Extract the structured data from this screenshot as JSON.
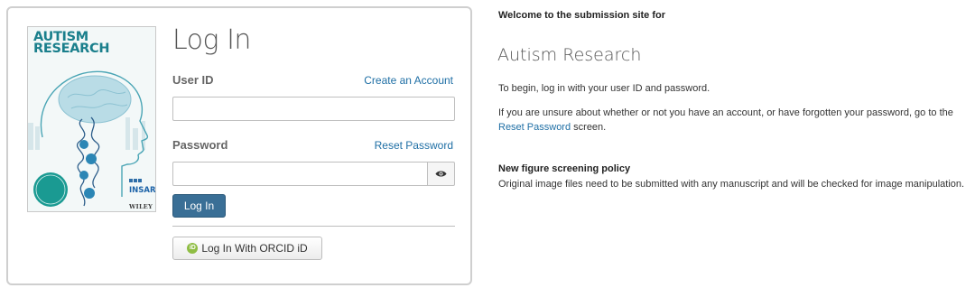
{
  "cover": {
    "title_line1": "AUTISM",
    "title_line2": "RESEARCH",
    "brand": "INSAR",
    "publisher": "WILEY",
    "accent_color": "#1a7f8c"
  },
  "login": {
    "title": "Log In",
    "user_id_label": "User ID",
    "create_account_link": "Create an Account",
    "user_id_value": "",
    "password_label": "Password",
    "reset_password_link": "Reset Password",
    "password_value": "",
    "show_password_icon": "eye-icon",
    "login_button": "Log In",
    "orcid_icon_text": "iD",
    "orcid_button": "Log In With ORCID iD",
    "primary_color": "#3a6f96",
    "orcid_color": "#8fbd44"
  },
  "info": {
    "welcome_heading": "Welcome to the submission site for",
    "journal_name": "Autism Research",
    "begin_text": "To begin, log in with your user ID and password.",
    "unsure_text_before": "If you are unsure about whether or not you have an account, or have forgotten your password, go to the ",
    "unsure_link": "Reset Password",
    "unsure_text_after": " screen.",
    "policy_heading": "New figure screening policy",
    "policy_text": "Original image files need to be submitted with any manuscript and will be checked for image manipulation.",
    "link_color": "#1f6fa5"
  }
}
